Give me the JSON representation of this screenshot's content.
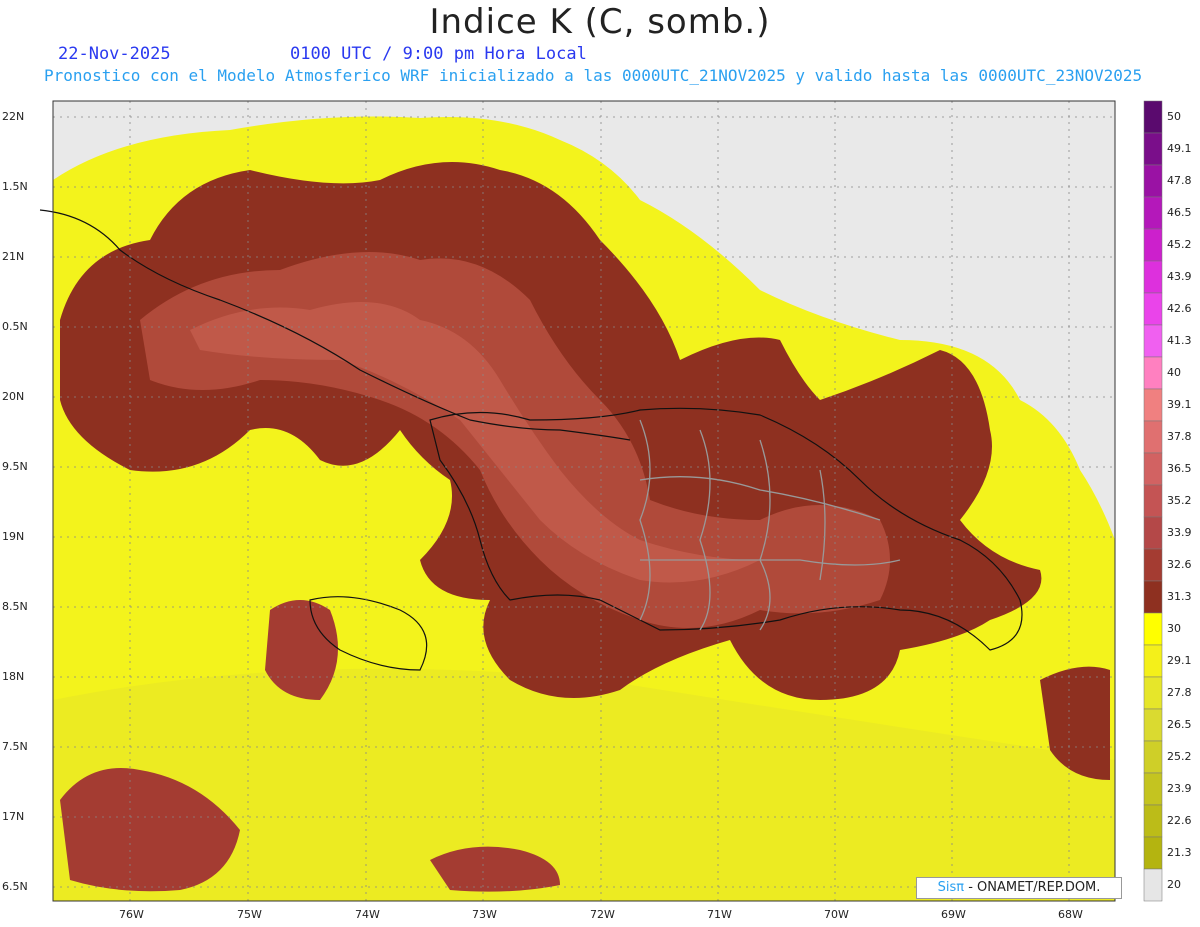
{
  "header": {
    "title": "Indice K (C, somb.)",
    "date": "22-Nov-2025",
    "time": "0100 UTC / 9:00 pm Hora Local",
    "subtitle": "Pronostico con el Modelo Atmosferico WRF inicializado a las 0000UTC_21NOV2025 y valido hasta las  0000UTC_23NOV2025"
  },
  "axes": {
    "lat_labels": [
      "22N",
      "1.5N",
      "21N",
      "0.5N",
      "20N",
      "9.5N",
      "19N",
      "8.5N",
      "18N",
      "7.5N",
      "17N",
      "6.5N"
    ],
    "lon_labels": [
      "76W",
      "75W",
      "74W",
      "73W",
      "72W",
      "71W",
      "70W",
      "69W",
      "68W"
    ]
  },
  "colorbar": {
    "labels": [
      "50",
      "49.1",
      "47.8",
      "46.5",
      "45.2",
      "43.9",
      "42.6",
      "41.3",
      "40",
      "39.1",
      "37.8",
      "36.5",
      "35.2",
      "33.9",
      "32.6",
      "31.3",
      "30",
      "29.1",
      "27.8",
      "26.5",
      "25.2",
      "23.9",
      "22.6",
      "21.3",
      "20"
    ],
    "colors": [
      "#5a0a6e",
      "#7a0e8a",
      "#9a12a4",
      "#b418ba",
      "#cc20cc",
      "#dd30dd",
      "#ea44ea",
      "#f060f0",
      "#ff80c0",
      "#f08080",
      "#e07070",
      "#d26262",
      "#c45454",
      "#b44848",
      "#a43c32",
      "#8e3020",
      "#ffff00",
      "#f4f01a",
      "#e6e62a",
      "#dada30",
      "#cfcf28",
      "#c4c420",
      "#bcbc18",
      "#b4b410",
      "#e6e6e6"
    ]
  },
  "credit": {
    "brand": "Sisπ",
    "org": " - ONAMET/REP.DOM."
  },
  "colors": {
    "background_land": "#e9e9e9",
    "low_k": "#f3f31c",
    "high_k": "#8e3020",
    "mid_k": "#b04a3a",
    "peak_k": "#c86050"
  }
}
